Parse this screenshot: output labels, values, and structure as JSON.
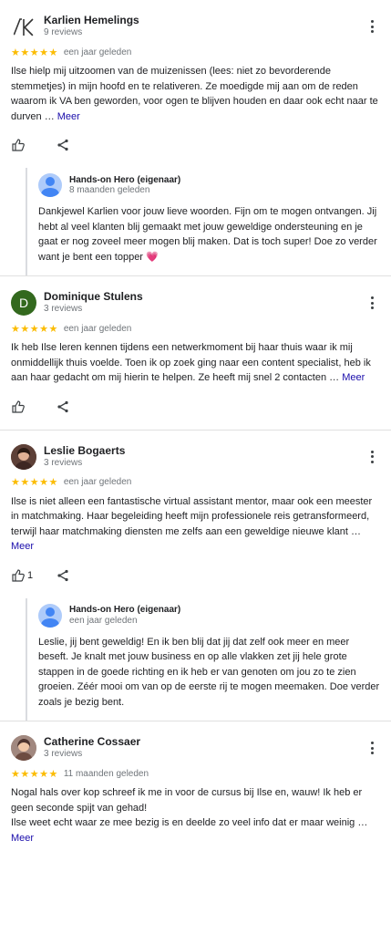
{
  "more_link": "Meer",
  "reviews": [
    {
      "name": "Karlien Hemelings",
      "count": "9 reviews",
      "stars": "★★★★★",
      "ago": "een jaar geleden",
      "text": "Ilse hielp mij uitzoomen van de muizenissen (lees: niet zo bevorderende stemmetjes) in mijn hoofd en te relativeren. Ze moedigde mij aan om de reden waarom ik VA ben geworden, voor ogen te blijven houden en daar ook echt naar te durven …",
      "likes": "",
      "reply": {
        "name": "Hands-on Hero (eigenaar)",
        "ago": "8 maanden geleden",
        "text": "Dankjewel Karlien voor jouw lieve woorden. Fijn om te mogen ontvangen. Jij hebt al veel klanten blij gemaakt met jouw geweldige ondersteuning en je gaat er nog zoveel meer mogen blij maken. Dat is toch super! Doe zo verder want je bent een topper 💗"
      }
    },
    {
      "name": "Dominique Stulens",
      "count": "3 reviews",
      "initial": "D",
      "stars": "★★★★★",
      "ago": "een jaar geleden",
      "text": "Ik heb Ilse leren kennen tijdens een netwerkmoment bij haar thuis waar ik mij onmiddellijk thuis voelde. Toen ik op zoek ging naar een content specialist, heb ik aan haar gedacht om mij hierin te helpen. Ze heeft mij snel 2 contacten …"
    },
    {
      "name": "Leslie Bogaerts",
      "count": "3 reviews",
      "stars": "★★★★★",
      "ago": "een jaar geleden",
      "text": "Ilse is niet alleen een fantastische virtual assistant mentor, maar ook een meester in matchmaking. Haar begeleiding heeft mijn professionele reis getransformeerd, terwijl haar matchmaking diensten me zelfs aan een geweldige nieuwe klant …",
      "likes": "1",
      "reply": {
        "name": "Hands-on Hero (eigenaar)",
        "ago": "een jaar geleden",
        "text": "Leslie, jij bent geweldig! En ik ben blij dat jij dat zelf ook meer en meer beseft. Je knalt met jouw business en op alle vlakken zet jij hele grote stappen in de goede richting en ik heb er van genoten om jou zo te zien groeien. Zéér mooi om van op de eerste rij te mogen meemaken. Doe verder zoals je bezig bent."
      }
    },
    {
      "name": "Catherine Cossaer",
      "count": "3 reviews",
      "stars": "★★★★★",
      "ago": "11 maanden geleden",
      "text": "Nogal hals over kop schreef ik me in voor de cursus bij Ilse en, wauw! Ik heb er geen seconde spijt van gehad!\nIlse weet echt waar ze mee bezig is en deelde zo veel info dat er maar weinig …"
    }
  ],
  "colors": {
    "star": "#fbbc04",
    "link": "#1a0dab",
    "avatar_green": "#33691e"
  }
}
